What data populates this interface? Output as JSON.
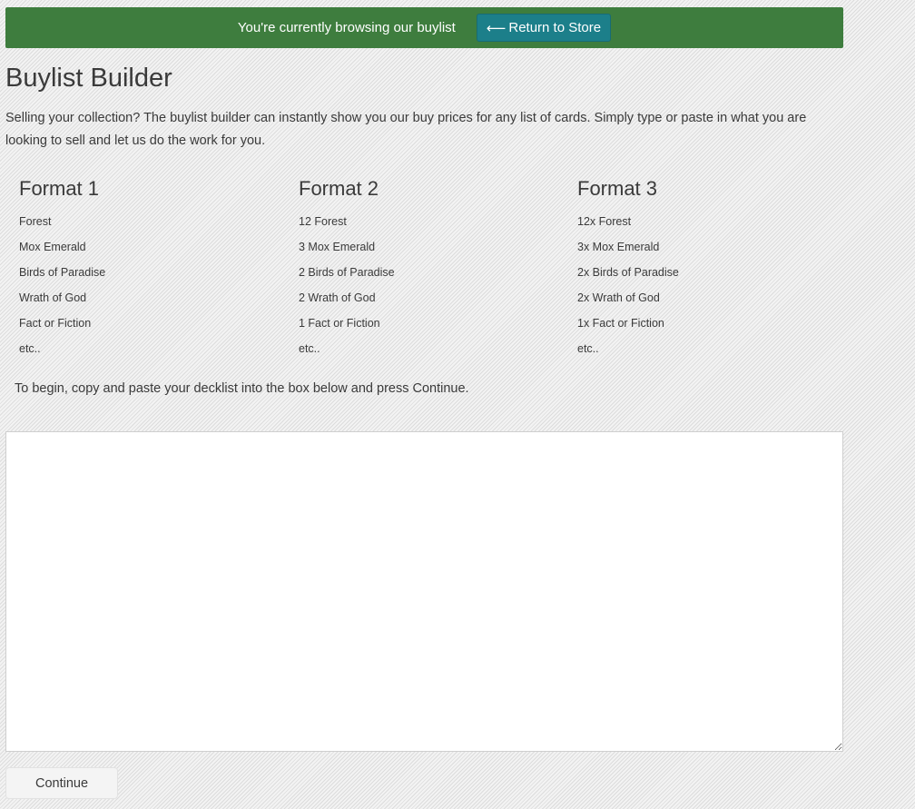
{
  "banner": {
    "message": "You're currently browsing our buylist",
    "return_arrow": "⟵",
    "return_label": "Return to Store",
    "bg_color": "#3e7d3e",
    "button_color": "#1c7f8a"
  },
  "page": {
    "title": "Buylist Builder",
    "intro": "Selling your collection? The buylist builder can instantly show you our buy prices for any list of cards. Simply type or paste in what you are looking to sell and let us do the work for you."
  },
  "formats": [
    {
      "title": "Format 1",
      "items": [
        "Forest",
        "Mox Emerald",
        "Birds of Paradise",
        "Wrath of God",
        "Fact or Fiction",
        "etc.."
      ]
    },
    {
      "title": "Format 2",
      "items": [
        "12 Forest",
        "3 Mox Emerald",
        "2 Birds of Paradise",
        "2 Wrath of God",
        "1 Fact or Fiction",
        "etc.."
      ]
    },
    {
      "title": "Format 3",
      "items": [
        "12x Forest",
        "3x Mox Emerald",
        "2x Birds of Paradise",
        "2x Wrath of God",
        "1x Fact or Fiction",
        "etc.."
      ]
    }
  ],
  "instructions": "To begin, copy and paste your decklist into the box below and press Continue.",
  "decklist": {
    "value": "",
    "placeholder": ""
  },
  "continue_label": "Continue"
}
